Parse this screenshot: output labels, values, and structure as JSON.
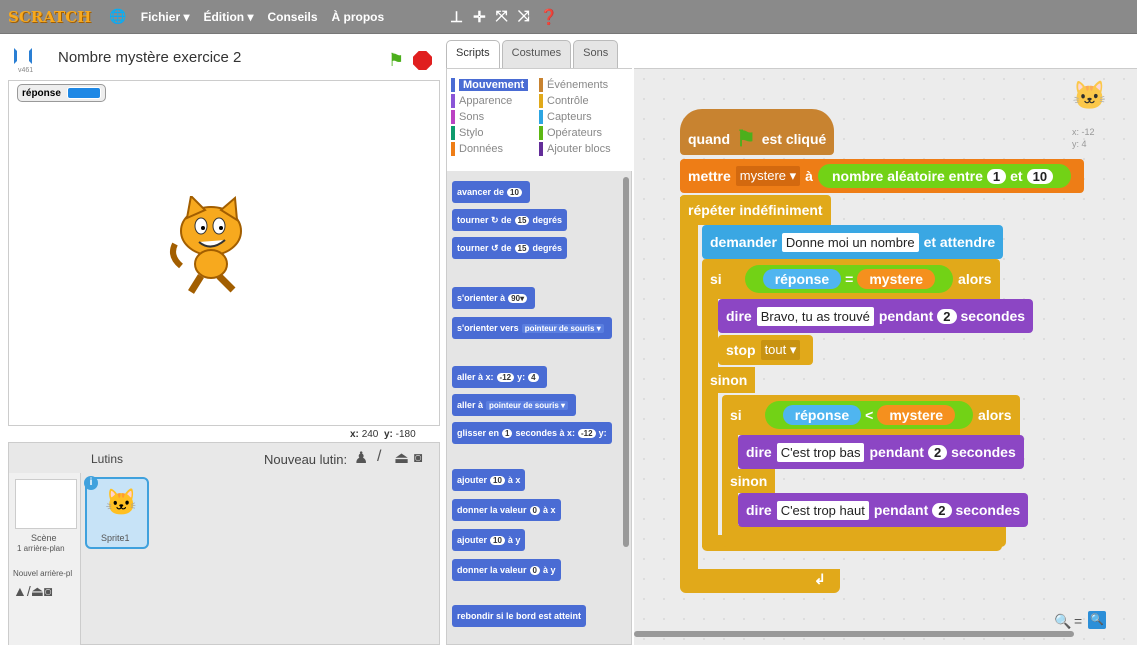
{
  "menubar": {
    "logo": "SCRATCH",
    "items": [
      "Fichier ▾",
      "Édition ▾",
      "Conseils",
      "À propos"
    ]
  },
  "stage": {
    "version": "v461",
    "project_title": "Nombre mystère exercice 2",
    "monitor_label": "réponse",
    "coords_x_label": "x:",
    "coords_x": "240",
    "coords_y_label": "y:",
    "coords_y": "-180"
  },
  "sprites": {
    "header": "Lutins",
    "new_sprite": "Nouveau lutin:",
    "scene_label": "Scène",
    "scene_sub": "1 arrière-plan",
    "new_backdrop": "Nouvel arrière-pl",
    "sprite_name": "Sprite1"
  },
  "tabs": [
    "Scripts",
    "Costumes",
    "Sons"
  ],
  "categories": [
    {
      "label": "Mouvement",
      "color": "#4a6cd4"
    },
    {
      "label": "Événements",
      "color": "#c88330"
    },
    {
      "label": "Apparence",
      "color": "#8a55d7"
    },
    {
      "label": "Contrôle",
      "color": "#e1a91a"
    },
    {
      "label": "Sons",
      "color": "#bb42c3"
    },
    {
      "label": "Capteurs",
      "color": "#2ca5e2"
    },
    {
      "label": "Stylo",
      "color": "#0e9a6c"
    },
    {
      "label": "Opérateurs",
      "color": "#5cb712"
    },
    {
      "label": "Données",
      "color": "#ee7d16"
    },
    {
      "label": "Ajouter blocs",
      "color": "#632d99"
    }
  ],
  "palette": {
    "avancer": "avancer de",
    "avancer_v": "10",
    "tourner_r": "tourner ↻ de",
    "tourner_r_v": "15",
    "degres": "degrés",
    "tourner_l": "tourner ↺ de",
    "tourner_l_v": "15",
    "orienter": "s'orienter à",
    "orienter_v": "90▾",
    "orienter_vers": "s'orienter vers",
    "pointeur": "pointeur de souris ▾",
    "aller_xy": "aller à x:",
    "aller_x": "-12",
    "aller_y_l": "y:",
    "aller_y": "4",
    "aller_a": "aller à",
    "pointeur2": "pointeur de souris ▾",
    "glisser": "glisser en",
    "glisser_v": "1",
    "glisser_t": "secondes à x:",
    "glisser_x": "-12",
    "glisser_y": "y:",
    "ajouter_x": "ajouter",
    "ajouter_x_v": "10",
    "ajouter_x_t": "à x",
    "donner_x": "donner la valeur",
    "donner_x_v": "0",
    "donner_x_t": "à x",
    "ajouter_y": "ajouter",
    "ajouter_y_v": "10",
    "ajouter_y_t": "à y",
    "donner_y": "donner la valeur",
    "donner_y_v": "0",
    "donner_y_t": "à y",
    "rebondir": "rebondir si le bord est atteint"
  },
  "script": {
    "hat_when": "quand",
    "hat_clicked": "est cliqué",
    "set": "mettre",
    "set_var": "mystere ▾",
    "set_to": "à",
    "random": "nombre aléatoire entre",
    "rand_a": "1",
    "rand_and": "et",
    "rand_b": "10",
    "forever": "répéter indéfiniment",
    "ask": "demander",
    "ask_text": "Donne moi un nombre",
    "ask_wait": "et attendre",
    "if1": "si",
    "then1": "alors",
    "reponse1": "réponse",
    "op_eq": "=",
    "mystere1": "mystere",
    "say1": "dire",
    "say1_text": "Bravo, tu as trouvé",
    "during1": "pendant",
    "sec1_v": "2",
    "sec1": "secondes",
    "stop": "stop",
    "stop_opt": "tout ▾",
    "else1": "sinon",
    "if2": "si",
    "then2": "alors",
    "reponse2": "réponse",
    "op_lt": "<",
    "mystere2": "mystere",
    "say2": "dire",
    "say2_text": "C'est trop bas",
    "during2": "pendant",
    "sec2_v": "2",
    "sec2": "secondes",
    "else2": "sinon",
    "say3": "dire",
    "say3_text": "C'est trop haut",
    "during3": "pendant",
    "sec3_v": "2",
    "sec3": "secondes",
    "loop_arrow": "↲",
    "sprite_x": "x: -12",
    "sprite_y": "y: 4"
  }
}
